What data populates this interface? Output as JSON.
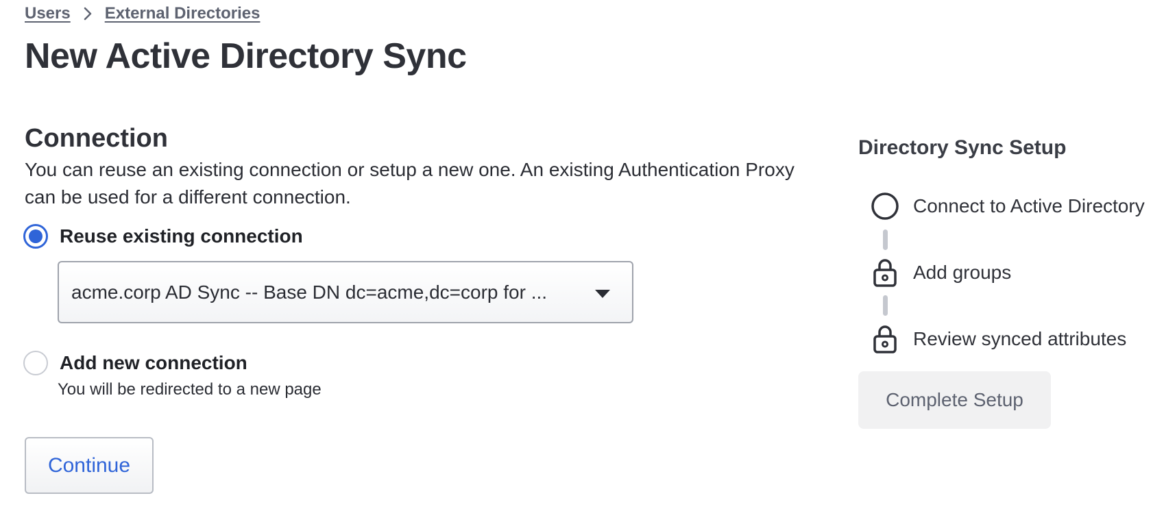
{
  "breadcrumb": {
    "items": [
      "Users",
      "External Directories"
    ]
  },
  "page": {
    "title": "New Active Directory Sync"
  },
  "connection": {
    "title": "Connection",
    "description": "You can reuse an existing connection or setup a new one. An existing Authentication Proxy can be used for a different connection.",
    "options": [
      {
        "label": "Reuse existing connection",
        "selected": true
      },
      {
        "label": "Add new connection",
        "selected": false,
        "helper": "You will be redirected to a new page"
      }
    ],
    "select_value": "acme.corp AD Sync -- Base DN dc=acme,dc=corp for ...",
    "continue_label": "Continue"
  },
  "sidebar": {
    "title": "Directory Sync Setup",
    "steps": [
      {
        "label": "Connect to Active Directory",
        "icon": "circle-icon"
      },
      {
        "label": "Add groups",
        "icon": "lock-icon"
      },
      {
        "label": "Review synced attributes",
        "icon": "lock-icon"
      }
    ],
    "complete_label": "Complete Setup"
  },
  "colors": {
    "accent": "#2f64d8",
    "text": "#2a2c33",
    "muted": "#5d6270"
  }
}
